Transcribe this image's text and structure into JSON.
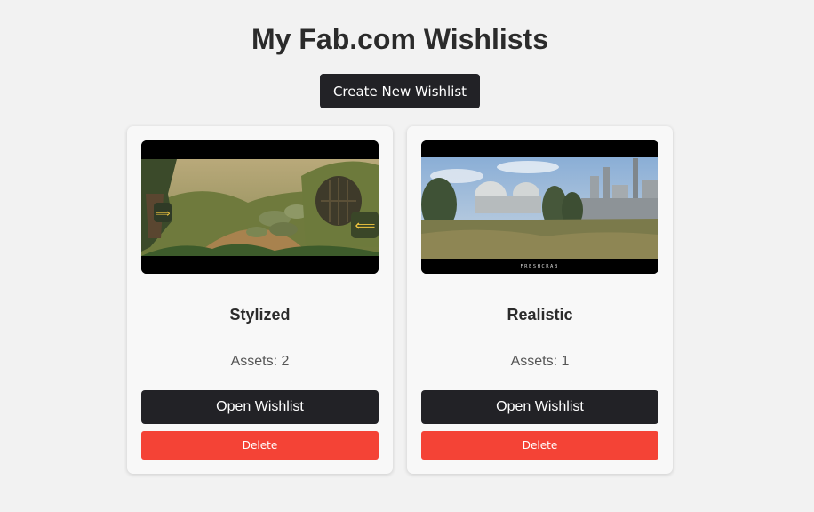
{
  "page": {
    "title": "My Fab.com Wishlists",
    "create_button_label": "Create New Wishlist"
  },
  "wishlists": [
    {
      "name": "Stylized",
      "assets_label": "Assets: 2",
      "open_label": "Open Wishlist",
      "delete_label": "Delete",
      "thumbnail": "stylized-forest-scene-image"
    },
    {
      "name": "Realistic",
      "assets_label": "Assets: 1",
      "open_label": "Open Wishlist",
      "delete_label": "Delete",
      "thumbnail": "realistic-industrial-landscape-image",
      "thumbnail_caption": "FRESHCRAB"
    }
  ],
  "colors": {
    "background": "#f2f2f2",
    "card": "#f8f8f8",
    "dark_button": "#222226",
    "delete_button": "#f44336",
    "title_text": "#2b2b2b"
  }
}
